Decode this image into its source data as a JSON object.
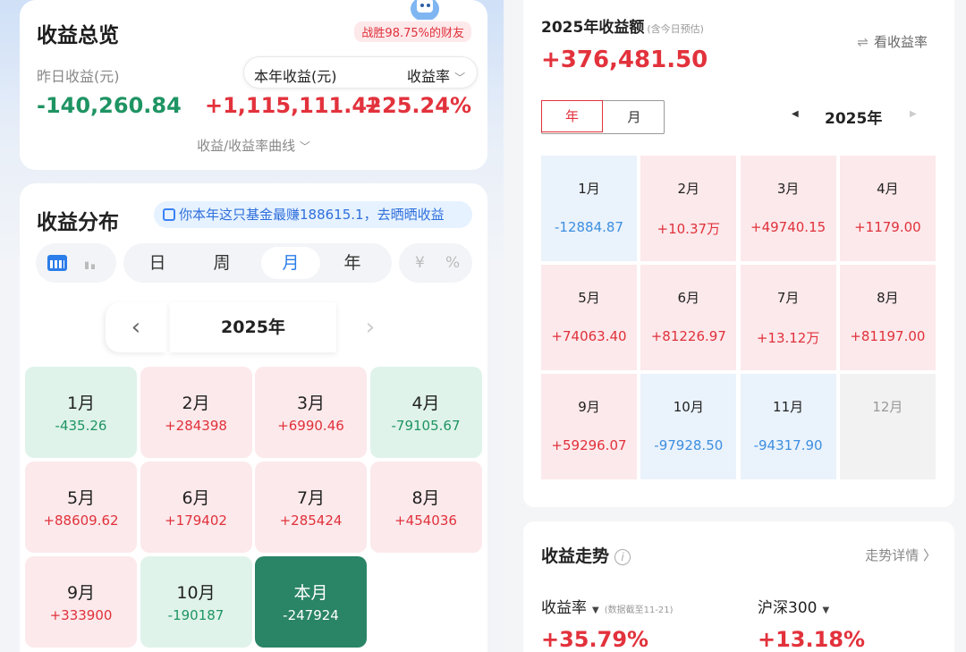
{
  "left": {
    "overview": {
      "title": "收益总览",
      "badge": "战胜98.75%的财友",
      "yesterday_label": "昨日收益(元)",
      "yesterday_value": "-140,260.84",
      "year_label": "本年收益(元)",
      "year_value": "+1,115,111.42",
      "rate_label": "收益率",
      "rate_value": "+25.24%",
      "curve_link": "收益/收益率曲线"
    },
    "distribution": {
      "title": "收益分布",
      "banner": "你本年这只基金最赚188615.1，去晒晒收益",
      "period_tabs": [
        "日",
        "周",
        "月",
        "年"
      ],
      "active_tab": "月",
      "unit_options": [
        "¥",
        "%"
      ],
      "year": "2025年",
      "months": [
        {
          "name": "1月",
          "value": "-435.26",
          "type": "neg"
        },
        {
          "name": "2月",
          "value": "+284398",
          "type": "pos"
        },
        {
          "name": "3月",
          "value": "+6990.46",
          "type": "pos"
        },
        {
          "name": "4月",
          "value": "-79105.67",
          "type": "neg"
        },
        {
          "name": "5月",
          "value": "+88609.62",
          "type": "pos"
        },
        {
          "name": "6月",
          "value": "+179402",
          "type": "pos"
        },
        {
          "name": "7月",
          "value": "+285424",
          "type": "pos"
        },
        {
          "name": "8月",
          "value": "+454036",
          "type": "pos"
        },
        {
          "name": "9月",
          "value": "+333900",
          "type": "pos"
        },
        {
          "name": "10月",
          "value": "-190187",
          "type": "neg"
        },
        {
          "name": "本月",
          "value": "-247924",
          "type": "cur"
        }
      ]
    }
  },
  "right": {
    "title": "2025年收益额",
    "title_note": "(含今日预估)",
    "total": "+376,481.50",
    "switch_label": "看收益率",
    "seg_year": "年",
    "seg_month": "月",
    "year": "2025年",
    "months": [
      {
        "name": "1月",
        "value": "-12884.87",
        "type": "neg"
      },
      {
        "name": "2月",
        "value": "+10.37万",
        "type": "pos"
      },
      {
        "name": "3月",
        "value": "+49740.15",
        "type": "pos"
      },
      {
        "name": "4月",
        "value": "+1179.00",
        "type": "pos"
      },
      {
        "name": "5月",
        "value": "+74063.40",
        "type": "pos"
      },
      {
        "name": "6月",
        "value": "+81226.97",
        "type": "pos"
      },
      {
        "name": "7月",
        "value": "+13.12万",
        "type": "pos"
      },
      {
        "name": "8月",
        "value": "+81197.00",
        "type": "pos"
      },
      {
        "name": "9月",
        "value": "+59296.07",
        "type": "pos"
      },
      {
        "name": "10月",
        "value": "-97928.50",
        "type": "neg"
      },
      {
        "name": "11月",
        "value": "-94317.90",
        "type": "neg"
      },
      {
        "name": "12月",
        "value": "",
        "type": "empty"
      }
    ],
    "trend": {
      "title": "收益走势",
      "detail_link": "走势详情",
      "rate_label": "收益率",
      "rate_note": "(数据截至11-21)",
      "rate_value": "+35.79%",
      "index_label": "沪深300",
      "index_value": "+13.18%"
    }
  },
  "colors": {
    "gain": "#e2323c",
    "loss_green": "#1f9463",
    "loss_blue": "#3d8fe0",
    "accent": "#2b7de9",
    "current_month": "#2a8466"
  }
}
